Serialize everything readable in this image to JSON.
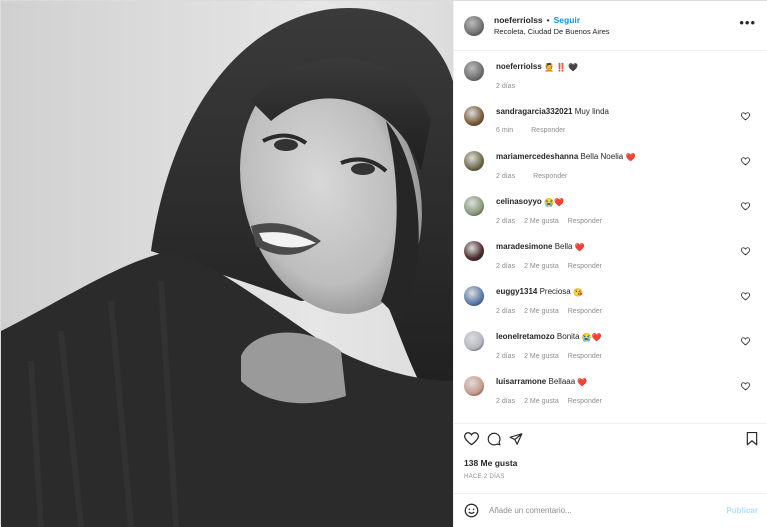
{
  "post": {
    "author": "noeferriolss",
    "dot": "•",
    "follow_label": "Seguir",
    "location": "Recoleta, Ciudad De Buenos Aires",
    "more_label": "•••",
    "caption_text": "💆 ‼️",
    "caption_heart": "🖤",
    "caption_time": "2 días"
  },
  "comments": [
    {
      "user": "sandragarcia332021",
      "text": "Muy linda",
      "emoji": "",
      "time": "6 min",
      "likes": "",
      "reply": "Responder",
      "avatar_color": "#7a5a3a"
    },
    {
      "user": "mariamercedeshanna",
      "text": "Bella Noelia",
      "emoji": "❤️",
      "time": "2 días",
      "likes": "",
      "reply": "Responder",
      "avatar_color": "#6f6a4a"
    },
    {
      "user": "celinasoyyo",
      "text": "",
      "emoji": "😭❤️",
      "time": "2 días",
      "likes": "2 Me gusta",
      "reply": "Responder",
      "avatar_color": "#8a9a7a"
    },
    {
      "user": "maradesimone",
      "text": "Bella",
      "emoji": "❤️",
      "time": "2 días",
      "likes": "2 Me gusta",
      "reply": "Responder",
      "avatar_color": "#4a2a2a"
    },
    {
      "user": "euggy1314",
      "text": "Preciosa",
      "emoji": "😘",
      "time": "2 días",
      "likes": "2 Me gusta",
      "reply": "Responder",
      "avatar_color": "#5a7aa8"
    },
    {
      "user": "leonelretamozo",
      "text": "Bonita",
      "emoji": "😭❤️",
      "time": "2 días",
      "likes": "2 Me gusta",
      "reply": "Responder",
      "avatar_color": "#b7b7c2"
    },
    {
      "user": "luisarramone",
      "text": "Bellaaa",
      "emoji": "❤️",
      "time": "2 días",
      "likes": "2 Me gusta",
      "reply": "Responder",
      "avatar_color": "#c79a8a"
    }
  ],
  "footer": {
    "likes": "138 Me gusta",
    "ago": "HACE 2 DÍAS",
    "comment_placeholder": "Añade un comentario...",
    "publish_label": "Publicar"
  },
  "colors": {
    "accent": "#0095f6",
    "publish_disabled": "#b2dffc",
    "muted": "#8e8e8e",
    "heart": "#d32f2f"
  }
}
